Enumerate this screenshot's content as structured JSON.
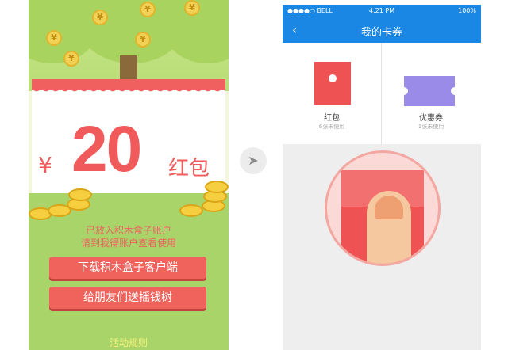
{
  "left_screen": {
    "currency_symbol": "¥",
    "amount": "20",
    "amount_unit": "红包",
    "message_line1": "已放入积木盒子账户",
    "message_line2": "请到我得账户查看使用",
    "download_button": "下载积木盒子客户端",
    "share_button": "给朋友们送摇钱树",
    "rules_link": "活动规则",
    "coin_glyph": "¥"
  },
  "arrow_glyph": "➤",
  "right_screen": {
    "status_bar": {
      "carrier": "●●●●○ BELL",
      "time": "4:21 PM",
      "battery": "100%"
    },
    "nav": {
      "back_glyph": "‹",
      "title": "我的卡券"
    },
    "tiles": [
      {
        "label": "红包",
        "sub": "6张未使用"
      },
      {
        "label": "优惠券",
        "sub": "1张未使用"
      }
    ]
  },
  "colors": {
    "brand_blue": "#1a87e5",
    "red": "#f05a5a",
    "green": "#a9d46a",
    "purple": "#9a8be9"
  }
}
